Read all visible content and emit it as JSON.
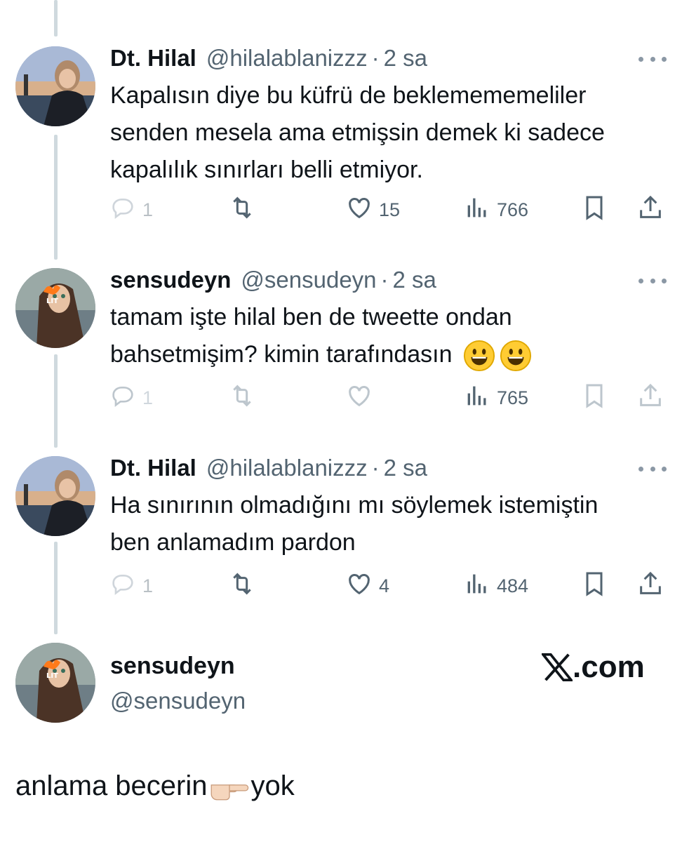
{
  "tweets": [
    {
      "name": "Dt. Hilal",
      "handle": "@hilalablanizzz",
      "separator": "·",
      "time": "2 sa",
      "text": "Kapalısın diye bu küfrü de beklemememeliler senden mesela ama etmişsin demek ki sadece kapalılık sınırları belli etmiyor.",
      "replies": "1",
      "likes": "15",
      "views": "766"
    },
    {
      "name": "sensudeyn",
      "handle": "@sensudeyn",
      "separator": "·",
      "time": "2 sa",
      "text": "tamam işte hilal ben de tweette ondan bahsetmişim? kimin tarafındasın",
      "replies": "1",
      "likes": "",
      "views": "765"
    },
    {
      "name": "Dt. Hilal",
      "handle": "@hilalablanizzz",
      "separator": "·",
      "time": "2 sa",
      "text": "Ha sınırının olmadığını mı söylemek istemiştin ben anlamadım pardon",
      "replies": "1",
      "likes": "4",
      "views": "484"
    }
  ],
  "final_tweet": {
    "name": "sensudeyn",
    "handle": "@sensudeyn",
    "brand": ".com",
    "brand_icon": "x-logo-icon",
    "text_before": "anlama becerin",
    "text_after": "yok",
    "emoji": "pointing-hand-icon"
  },
  "icons": [
    "reply-icon",
    "retweet-icon",
    "like-icon",
    "views-icon",
    "bookmark-icon",
    "share-icon",
    "more-icon",
    "smiley-icon"
  ],
  "colors": {
    "text": "#0f1419",
    "secondary": "#536471",
    "thread_line": "#cfd9de"
  }
}
